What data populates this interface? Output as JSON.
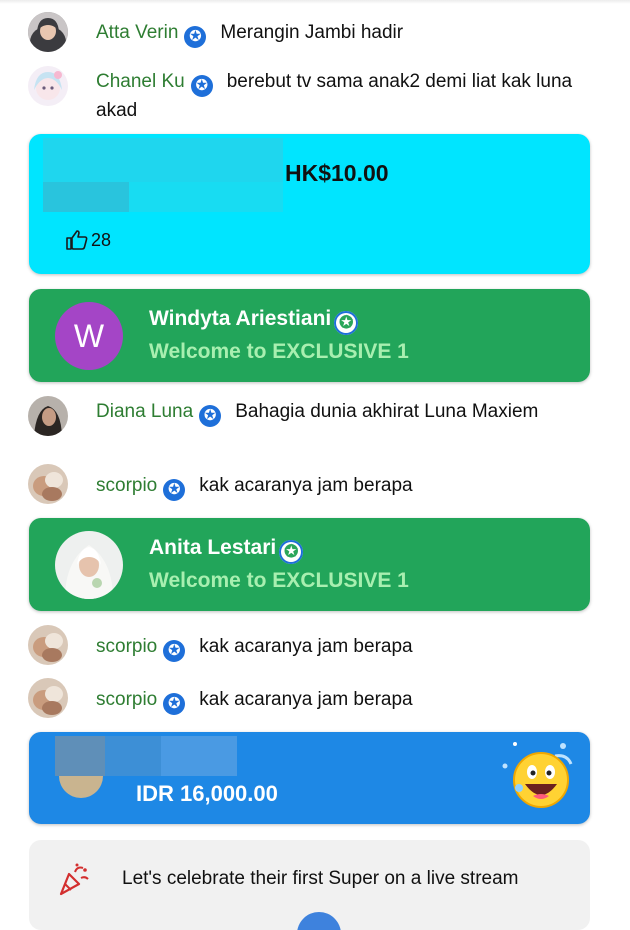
{
  "verified_glyph": "✪",
  "colors": {
    "author_green": "#2e7d32",
    "verified_blue": "#1e6fd9",
    "superchat_cyan": "#00e5ff",
    "membership_green": "#22a55a",
    "superchat_blue": "#1e88e5",
    "celebrate_bg": "#f1f1f1"
  },
  "messages": [
    {
      "author": "Atta Verin",
      "text": "Merangin Jambi hadir"
    },
    {
      "author": "Chanel Ku",
      "text": "berebut tv sama anak2 demi liat kak luna akad"
    },
    {
      "author": "Diana Luna",
      "text": "Bahagia dunia akhirat Luna Maxiem"
    },
    {
      "author": "scorpio",
      "text": "kak acaranya jam berapa"
    },
    {
      "author": "scorpio",
      "text": "kak acaranya jam berapa"
    },
    {
      "author": "scorpio",
      "text": "kak acaranya jam berapa"
    }
  ],
  "superchat_1": {
    "amount": "HK$10.00",
    "likes": "28",
    "like_icon": "thumbs-up-icon"
  },
  "memberships": [
    {
      "initial": "W",
      "name": "Windyta Ariestiani",
      "welcome": "Welcome to EXCLUSIVE 1"
    },
    {
      "initial": "",
      "name": "Anita Lestari",
      "welcome": "Welcome to EXCLUSIVE 1"
    }
  ],
  "superchat_2": {
    "amount": "IDR 16,000.00",
    "sticker_icon": "laughing-emoji-icon"
  },
  "celebrate": {
    "text": "Let's celebrate their first Super on a live stream",
    "icon": "party-popper-icon"
  }
}
